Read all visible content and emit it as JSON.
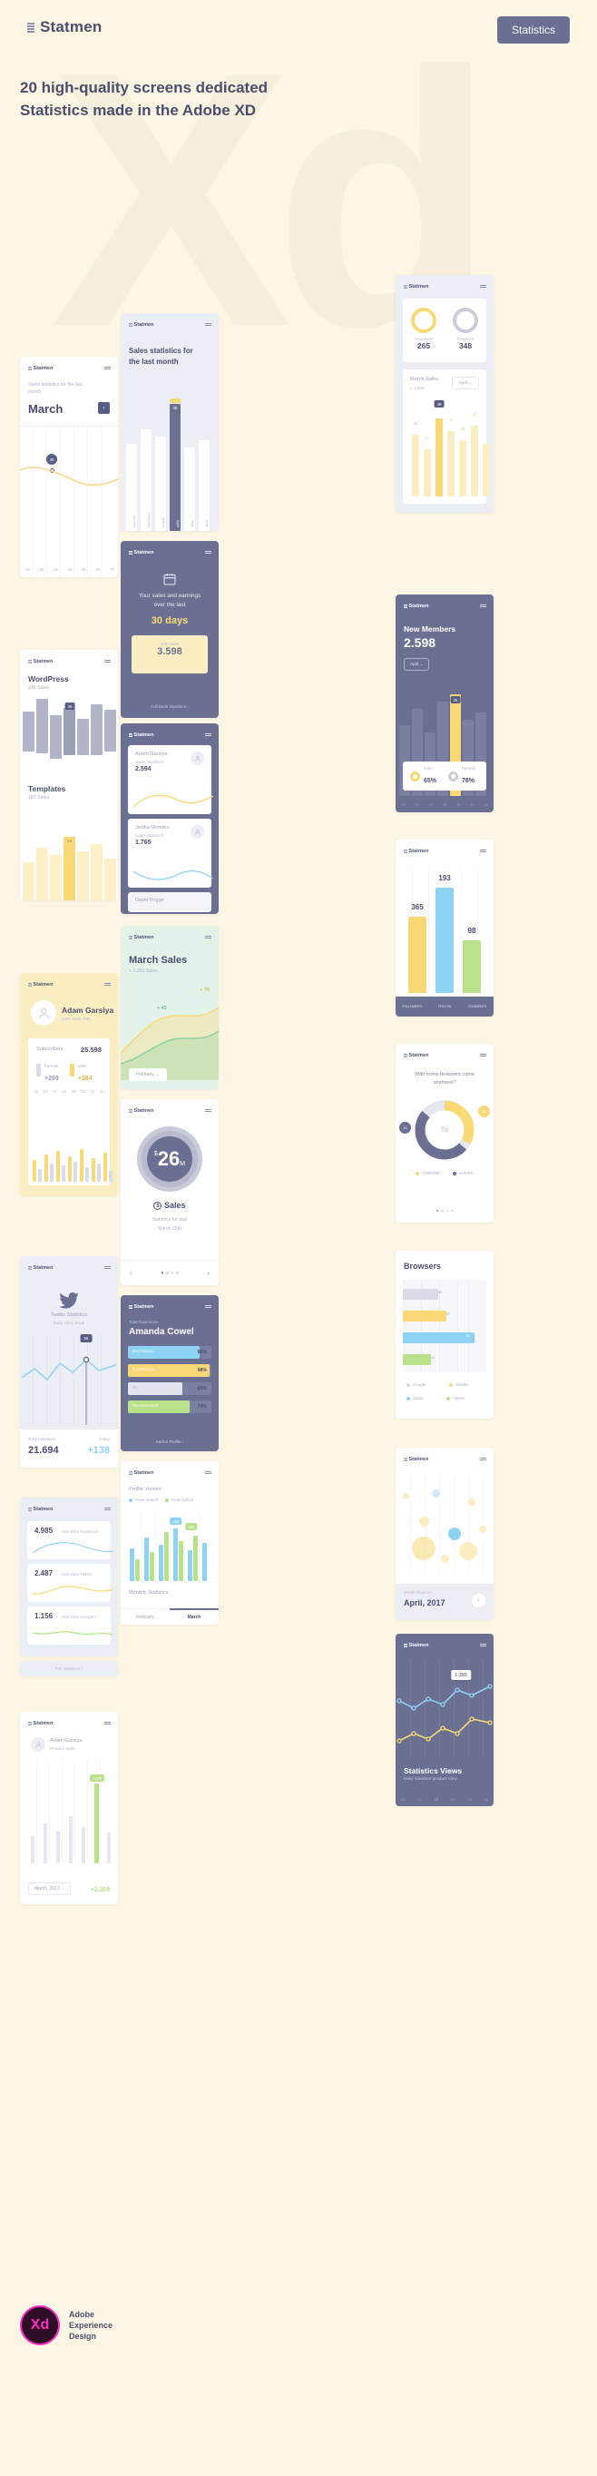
{
  "header": {
    "brand": "Statmen",
    "cta_label": "Statistics",
    "hero": "20 high-quality screens dedicated Statistics made in the Adobe XD"
  },
  "footer": {
    "logo_text": "Xd",
    "name_line1": "Adobe",
    "name_line2": "Experience",
    "name_line3": "Design"
  },
  "brand_mark": "Statmen",
  "colors": {
    "bg": "#fdf6e4",
    "ink": "#4a4f6e",
    "slate": "#6b7093",
    "yellow": "#f9d976",
    "blue": "#8fd3f4",
    "green": "#a8e063",
    "lilac": "#eceef5"
  },
  "cards": {
    "march_sales_line": {
      "title": "March",
      "subtitle": "Sales statistics for the last month",
      "arrow": "›",
      "tooltip": "35",
      "axis": [
        "10",
        "20",
        "30",
        "40",
        "50",
        "60",
        "70"
      ]
    },
    "wordpress": {
      "title": "WordPress",
      "subtitle": "248 Sales",
      "title2": "Templates",
      "subtitle2": "187 Sales",
      "tooltip": "35",
      "tooltip2": "28"
    },
    "subscribers": {
      "user_name": "Adam Garsiya",
      "user_loc": "USA, New York",
      "panel_label": "Subscribers",
      "panel_value": "25.598",
      "legend": [
        {
          "label": "Female",
          "value": "+269",
          "color": "#d9dce7"
        },
        {
          "label": "Male",
          "value": "+384",
          "color": "#f9d976"
        }
      ],
      "axis": [
        "15",
        "16",
        "17",
        "18",
        "19",
        "20",
        "21",
        "22"
      ]
    },
    "twitter": {
      "title": "Twitter Statistics",
      "subtitle": "Daily, Mon, Enab",
      "tooltip": "59",
      "foot_label1": "Total Followers",
      "foot_value1": "21.694",
      "foot_label2": "Today",
      "foot_value2": "+138"
    },
    "visits": {
      "rows": [
        {
          "value": "4.985",
          "label": "Vizit from Facebook"
        },
        {
          "value": "2.487",
          "label": "Vizit from Twitter"
        },
        {
          "value": "1.156",
          "label": "Vizit from Google+"
        }
      ],
      "footer": "Full Statistics ›"
    },
    "adam_bars": {
      "user_name": "Adam Garsiya",
      "user_sub": "Product Sales",
      "tooltip": "+128",
      "select": "March, 2017",
      "delta": "+2.369"
    },
    "sales_stats_mid": {
      "title": "Sales statistics for the last month",
      "tooltip": "35",
      "months": [
        "January",
        "February",
        "March",
        "April",
        "May",
        "June"
      ]
    },
    "earnings": {
      "line1": "Your sales and earnings",
      "line2": "over the last",
      "big": "30 days",
      "panel_label": "30$ Sales",
      "panel_value": "3.598",
      "link": "Full Bank Statistics ›"
    },
    "people": {
      "items": [
        {
          "name": "Adam Garsiya",
          "sub": "Sales Statistics",
          "value": "2.594"
        },
        {
          "name": "Jesika Montero",
          "sub": "Sales Statistics",
          "value": "1.765"
        },
        {
          "name": "David Frigge",
          "sub": "Sales Statistics",
          "value": ""
        }
      ]
    },
    "march_sales_area": {
      "title": "March Sales",
      "subtitle": "+ 1.259 Sales",
      "label_a": "+ 76",
      "label_b": "+ 45",
      "select": "February"
    },
    "sales_gauge": {
      "currency": "$",
      "value": "26",
      "unit": "M",
      "label": "Sales",
      "sub1": "Statistics for sale",
      "sub2": "March 25th",
      "prev": "‹",
      "next": "›"
    },
    "amanda": {
      "eyebrow": "Total Experience",
      "name": "Amanda Cowel",
      "rows": [
        {
          "label": "PHOTOSHOP",
          "value": "86%",
          "color": "#8fd3f4",
          "w": 86
        },
        {
          "label": "ILLUSTRATOR",
          "value": "98%",
          "color": "#f9d976",
          "w": 98
        },
        {
          "label": "XD",
          "value": "65%",
          "color": "#d9dce7",
          "w": 65
        },
        {
          "label": "DREAMWEAVER",
          "value": "74%",
          "color": "#b9e08a",
          "w": 74
        }
      ],
      "footer": "Author Profile ›"
    },
    "profile_visitors": {
      "title": "Profile Visitors",
      "legend": [
        {
          "label": "From Search",
          "color": "#8fd3f4"
        },
        {
          "label": "From Social",
          "color": "#b9e08a"
        }
      ],
      "tips": [
        "265",
        "281"
      ],
      "bottom_title": "Monthly Statistics",
      "tabs": [
        "February",
        "March"
      ]
    },
    "donuts": {
      "items": [
        {
          "label": "Templates",
          "value": "265",
          "color": "#f9d976"
        },
        {
          "label": "Graphics",
          "value": "348",
          "color": "#c9cdda"
        }
      ]
    },
    "march_sales_bars": {
      "title": "March Sales",
      "subtitle": "+ 1.543",
      "select": "April",
      "tooltip": "48",
      "values": [
        "36",
        "27",
        "48",
        "39",
        "44",
        "41",
        "33"
      ]
    },
    "new_members": {
      "title": "New Members",
      "value": "2.598",
      "select": "April",
      "tooltip": "35",
      "legend": [
        {
          "label": "Male",
          "value": "65%",
          "color": "#f9d976"
        },
        {
          "label": "Female",
          "value": "78%",
          "color": "#c9cdda"
        }
      ],
      "axis": [
        "15",
        "16",
        "17",
        "18",
        "19",
        "20",
        "21"
      ]
    },
    "three_bars": {
      "values": [
        "365",
        "193",
        "98"
      ],
      "labels": [
        "FOLLOWERS",
        "FOLLOW",
        "COMMENTS"
      ],
      "colors": [
        "#f9d976",
        "#8fd3f4",
        "#b9e08a"
      ]
    },
    "browsers_donut": {
      "title": "With some browsers come anymore?",
      "badge_left": "1k",
      "badge_right": "3k",
      "center_icon": "%",
      "legend": [
        {
          "label": "CHROME",
          "color": "#f9d976"
        },
        {
          "label": "SAFARI",
          "color": "#6b7093"
        }
      ]
    },
    "browsers_bars": {
      "title": "Browsers",
      "bars": [
        {
          "value": "58",
          "color": "#d9dce7",
          "w": 42
        },
        {
          "value": "57",
          "color": "#f9d976",
          "w": 52
        },
        {
          "value": "84",
          "color": "#8fd3f4",
          "w": 86
        },
        {
          "value": "41",
          "color": "#b9e08a",
          "w": 34
        }
      ],
      "legend": [
        "Google",
        "Mozilla",
        "Safari",
        "Opera"
      ]
    },
    "bubbles": {
      "footer_label": "Month Projects",
      "footer_value": "April, 2017",
      "arrow": "›"
    },
    "statistics_views": {
      "tooltip": "1.389",
      "title": "Statistics Views",
      "subtitle": "Daily statistics product view",
      "axis": [
        "06",
        "07",
        "08",
        "09",
        "10",
        "11"
      ]
    }
  }
}
